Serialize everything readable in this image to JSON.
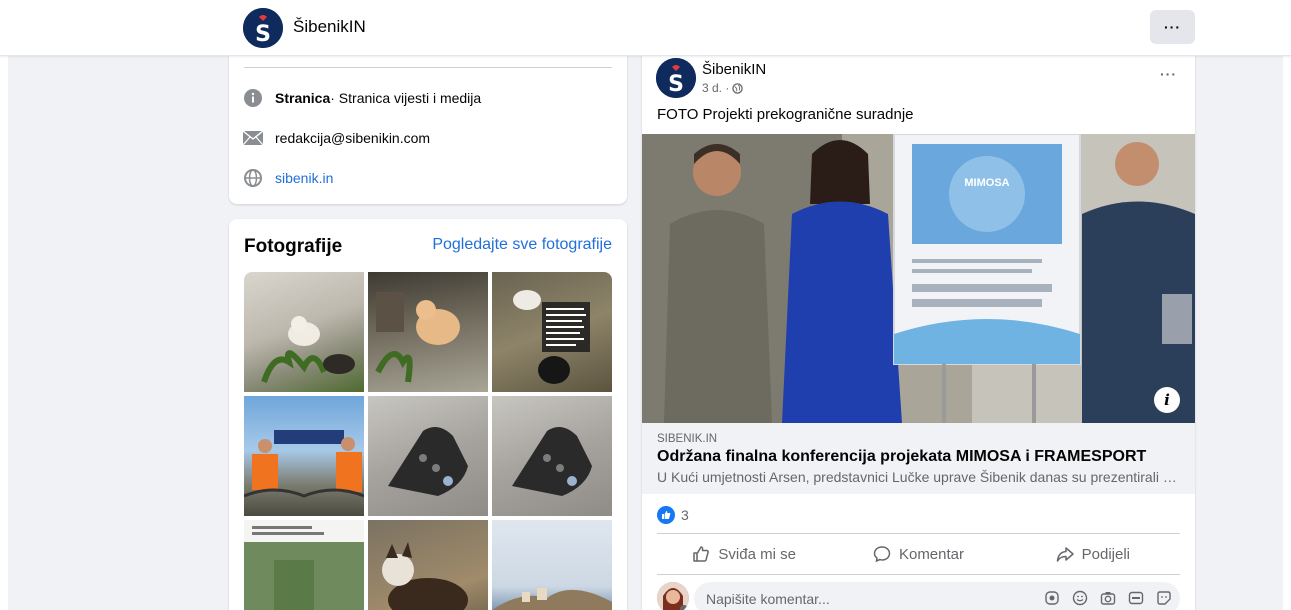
{
  "page": {
    "name": "ŠibenikIN"
  },
  "intro": {
    "category_bold": "Stranica",
    "category_rest": " · Stranica vijesti i medija",
    "email": "redakcija@sibenikin.com",
    "website": "sibenik.in"
  },
  "photos": {
    "title": "Fotografije",
    "see_all": "Pogledajte sve fotografije",
    "count": 9
  },
  "post": {
    "author": "ŠibenikIN",
    "time": "3 d. ·",
    "text": "FOTO Projekti prekogranične suradnje",
    "poster_title": "MIMOSA",
    "link_domain": "SIBENIK.IN",
    "link_title": "Održana finalna konferencija projekata MIMOSA i FRAMESPORT",
    "link_desc": "U Kući umjetnosti Arsen, predstavnici Lučke uprave Šibenik danas su prezentirali …",
    "like_count": "3",
    "actions": {
      "like": "Sviđa mi se",
      "comment": "Komentar",
      "share": "Podijeli"
    },
    "comment_placeholder": "Napišite komentar..."
  },
  "colors": {
    "brand_navy": "#0f2a5c",
    "brand_red": "#e63a3a",
    "link_blue": "#216fdb",
    "like_blue": "#1877f2"
  }
}
